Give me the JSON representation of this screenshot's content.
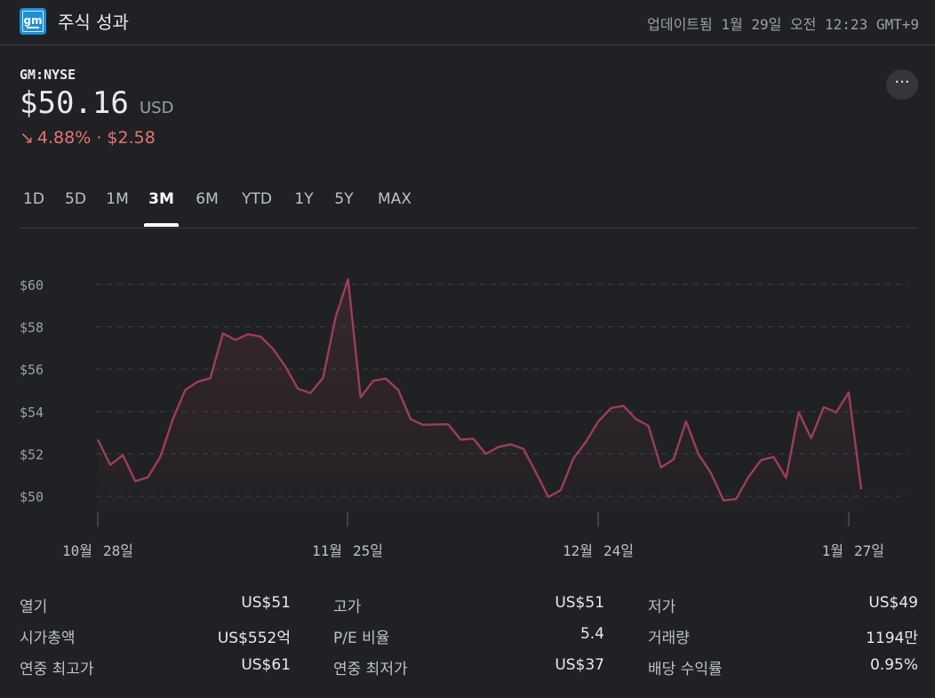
{
  "header": {
    "title": "주식 성과",
    "logo_text": "gm",
    "updated": "업데이트됨 1월 29일 오전 12:23 GMT+9"
  },
  "quote": {
    "ticker": "GM:NYSE",
    "price": "$50.16",
    "currency": "USD",
    "change_arrow": "↘",
    "change": "4.88% · $2.58",
    "more_label": "···"
  },
  "colors": {
    "down": "#e57373",
    "line": "#9e3e55",
    "background": "#202124"
  },
  "tabs": [
    {
      "label": "1D"
    },
    {
      "label": "5D"
    },
    {
      "label": "1M"
    },
    {
      "label": "3M",
      "active": true
    },
    {
      "label": "6M"
    },
    {
      "label": "YTD"
    },
    {
      "label": "1Y"
    },
    {
      "label": "5Y"
    },
    {
      "label": "MAX"
    }
  ],
  "chart_data": {
    "type": "line",
    "y_ticks": [
      "$60",
      "$58",
      "$56",
      "$54",
      "$52",
      "$50"
    ],
    "x_labels": [
      {
        "month": "10월",
        "day": "28일"
      },
      {
        "month": "11월",
        "day": "25일"
      },
      {
        "month": "12월",
        "day": "24일"
      },
      {
        "month": "1월",
        "day": "27일"
      }
    ],
    "ylim": [
      49.5,
      60.5
    ],
    "grid": true,
    "values": [
      52.68,
      51.48,
      51.94,
      50.71,
      50.89,
      51.86,
      53.64,
      55.03,
      55.41,
      55.58,
      57.69,
      57.38,
      57.65,
      57.54,
      56.97,
      56.12,
      55.07,
      54.87,
      55.6,
      58.46,
      60.24,
      54.67,
      55.45,
      55.56,
      55.02,
      53.64,
      53.37,
      53.39,
      53.39,
      52.67,
      52.72,
      52.0,
      52.32,
      52.45,
      52.24,
      51.13,
      49.96,
      50.29,
      51.78,
      52.57,
      53.54,
      54.16,
      54.27,
      53.65,
      53.32,
      51.36,
      51.74,
      53.53,
      51.98,
      51.09,
      49.8,
      49.87,
      50.92,
      51.71,
      51.86,
      50.87,
      53.97,
      52.74,
      54.21,
      53.96,
      54.9,
      50.33
    ]
  },
  "stats": [
    {
      "label": "열기",
      "value": "US$51"
    },
    {
      "label": "고가",
      "value": "US$51"
    },
    {
      "label": "저가",
      "value": "US$49"
    },
    {
      "label": "시가총액",
      "value": "US$552억"
    },
    {
      "label": "P/E 비율",
      "value": "5.4"
    },
    {
      "label": "거래량",
      "value": "1194만"
    },
    {
      "label": "연중 최고가",
      "value": "US$61"
    },
    {
      "label": "연중 최저가",
      "value": "US$37"
    },
    {
      "label": "배당 수익률",
      "value": "0.95%"
    }
  ]
}
